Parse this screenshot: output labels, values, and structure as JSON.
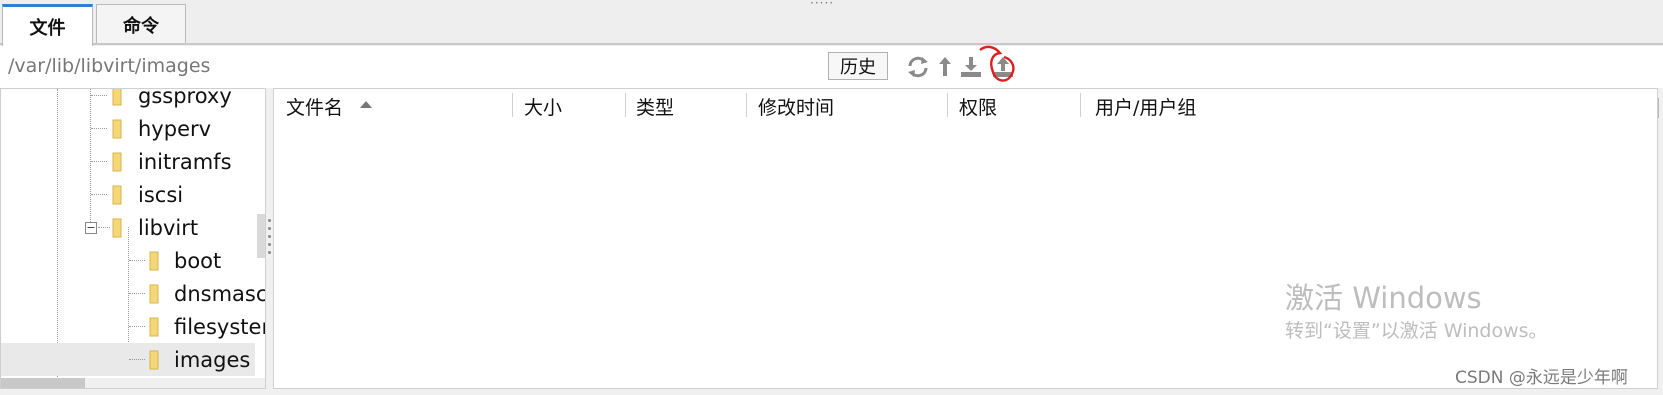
{
  "tabs": [
    {
      "label": "文件",
      "active": true
    },
    {
      "label": "命令",
      "active": false
    }
  ],
  "toolbar": {
    "path": "/var/lib/libvirt/images",
    "history_label": "历史",
    "icons": [
      "refresh-icon",
      "up-directory-icon",
      "download-icon",
      "upload-icon"
    ]
  },
  "tree": {
    "items": [
      {
        "label": "gssproxy",
        "level": 1
      },
      {
        "label": "hyperv",
        "level": 1
      },
      {
        "label": "initramfs",
        "level": 1
      },
      {
        "label": "iscsi",
        "level": 1
      },
      {
        "label": "libvirt",
        "level": 1,
        "expanded": true
      },
      {
        "label": "boot",
        "level": 2
      },
      {
        "label": "dnsmasc",
        "level": 2
      },
      {
        "label": "filesyster",
        "level": 2
      },
      {
        "label": "images",
        "level": 2,
        "selected": true
      }
    ]
  },
  "file_list": {
    "columns": [
      "文件名",
      "大小",
      "类型",
      "修改时间",
      "权限",
      "用户/用户组"
    ],
    "sorted_by": "文件名",
    "rows": []
  },
  "watermark": {
    "title": "激活 Windows",
    "subtitle": "转到“设置”以激活 Windows。"
  },
  "credit": "CSDN @永远是少年啊",
  "colors": {
    "active_tab_accent": "#2f7fd6",
    "folder": "#f5d77a",
    "annotation": "#e02020"
  }
}
